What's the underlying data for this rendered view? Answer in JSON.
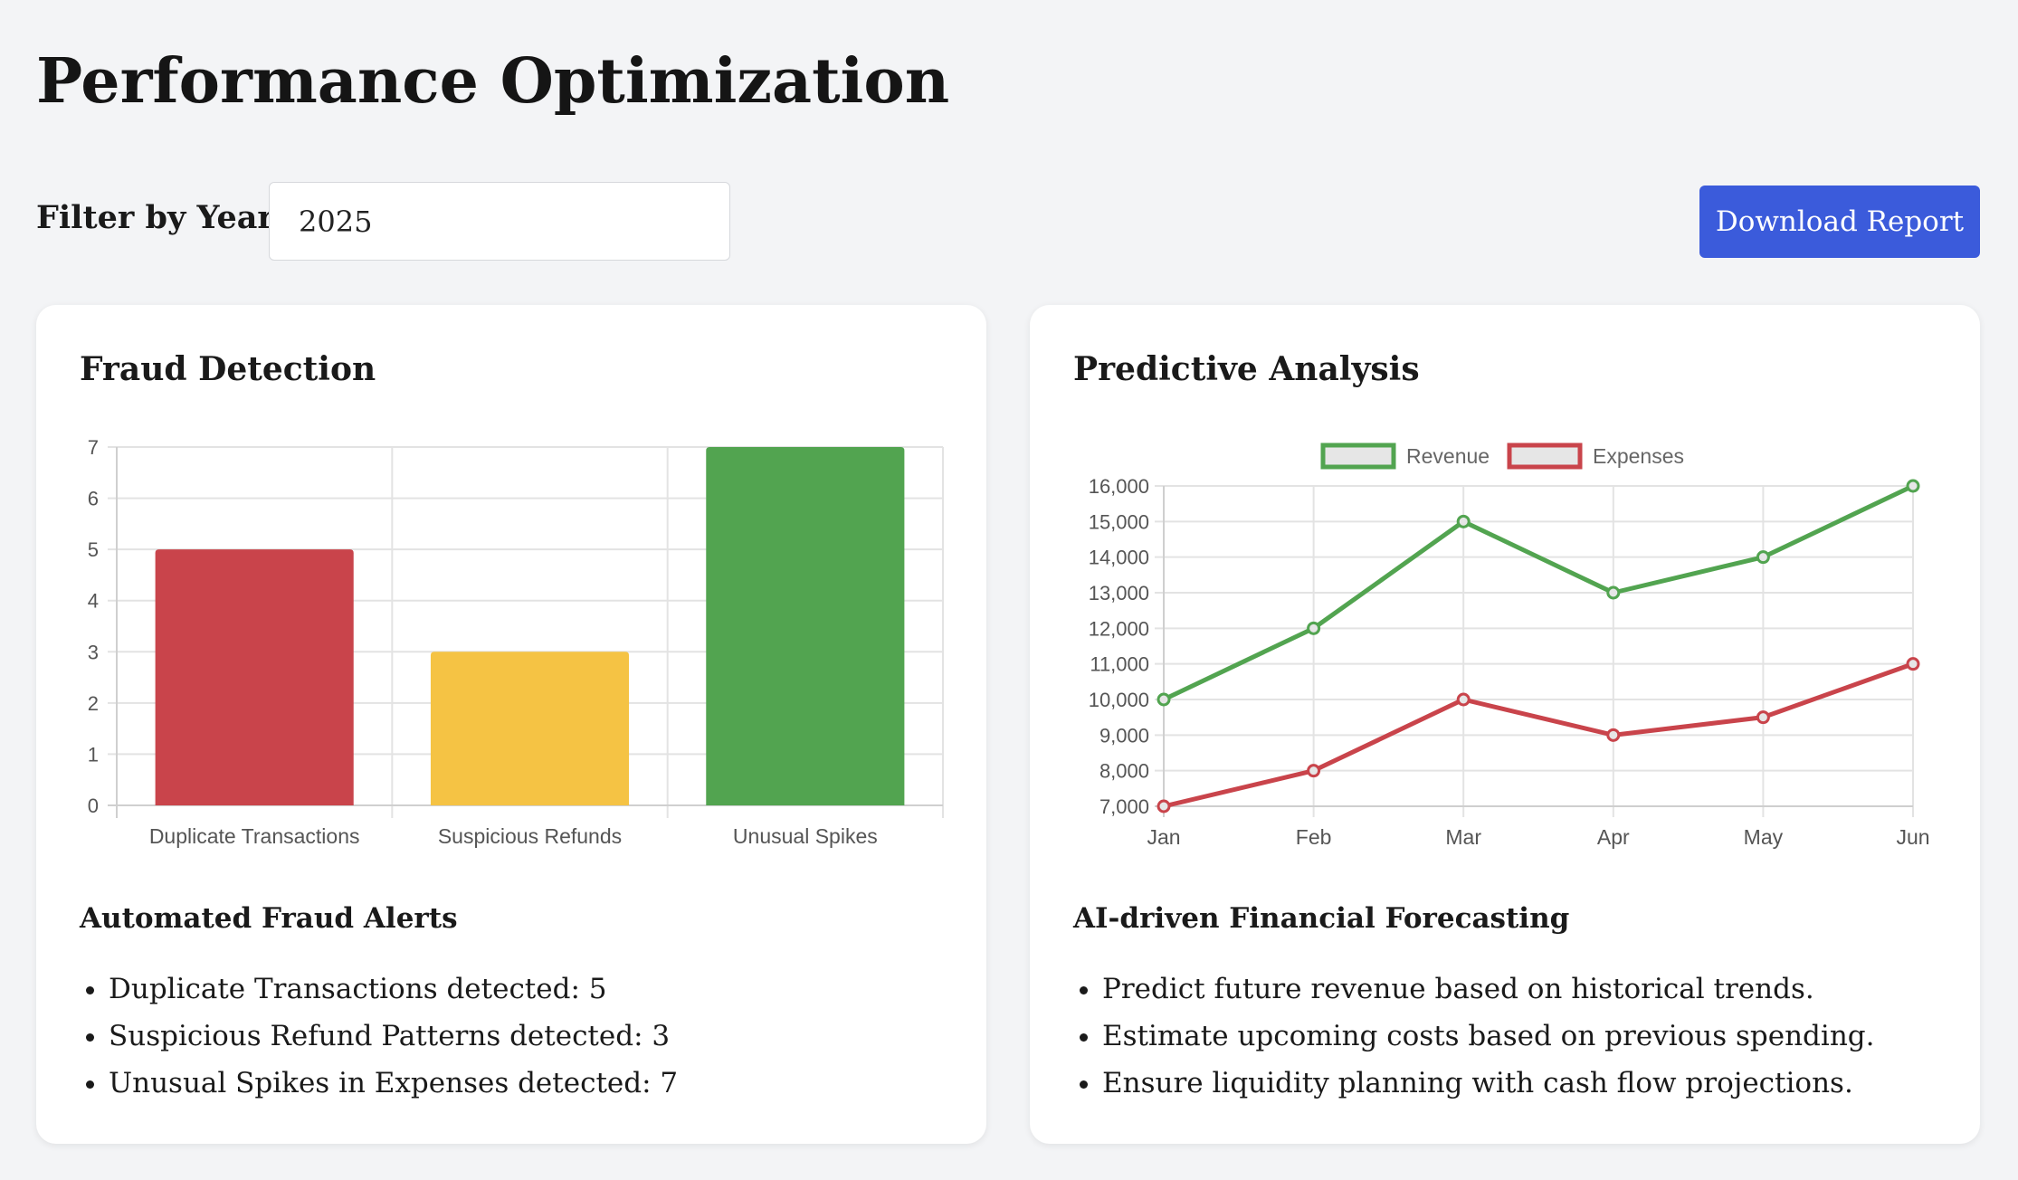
{
  "page": {
    "title": "Performance Optimization"
  },
  "filter": {
    "label": "Filter by Year:",
    "value": "2025"
  },
  "toolbar": {
    "download_label": "Download Report"
  },
  "colors": {
    "accent": "#3b5bdb",
    "red": "#c9444b",
    "yellow": "#f5c344",
    "green": "#52a450"
  },
  "fraud": {
    "title": "Fraud Detection",
    "subtitle": "Automated Fraud Alerts",
    "alerts": [
      "Duplicate Transactions detected: 5",
      "Suspicious Refund Patterns detected: 3",
      "Unusual Spikes in Expenses detected: 7"
    ]
  },
  "predictive": {
    "title": "Predictive Analysis",
    "subtitle": "AI-driven Financial Forecasting",
    "points": [
      "Predict future revenue based on historical trends.",
      "Estimate upcoming costs based on previous spending.",
      "Ensure liquidity planning with cash flow projections."
    ]
  },
  "chart_data": [
    {
      "type": "bar",
      "categories": [
        "Duplicate Transactions",
        "Suspicious Refunds",
        "Unusual Spikes"
      ],
      "values": [
        5,
        3,
        7
      ],
      "colors": [
        "#c9444b",
        "#f5c344",
        "#52a450"
      ],
      "ylim": [
        0,
        7
      ],
      "yticks": [
        "0",
        "1",
        "2",
        "3",
        "4",
        "5",
        "6",
        "7"
      ],
      "grid": true
    },
    {
      "type": "line",
      "x": [
        "Jan",
        "Feb",
        "Mar",
        "Apr",
        "May",
        "Jun"
      ],
      "series": [
        {
          "name": "Revenue",
          "values": [
            10000,
            12000,
            15000,
            13000,
            14000,
            16000
          ],
          "color": "#52a450"
        },
        {
          "name": "Expenses",
          "values": [
            7000,
            8000,
            10000,
            9000,
            9500,
            11000
          ],
          "color": "#c9444b"
        }
      ],
      "ylim": [
        7000,
        16000
      ],
      "yticks": [
        "7,000",
        "8,000",
        "9,000",
        "10,000",
        "11,000",
        "12,000",
        "13,000",
        "14,000",
        "15,000",
        "16,000"
      ],
      "legend": "top",
      "grid": true
    }
  ]
}
